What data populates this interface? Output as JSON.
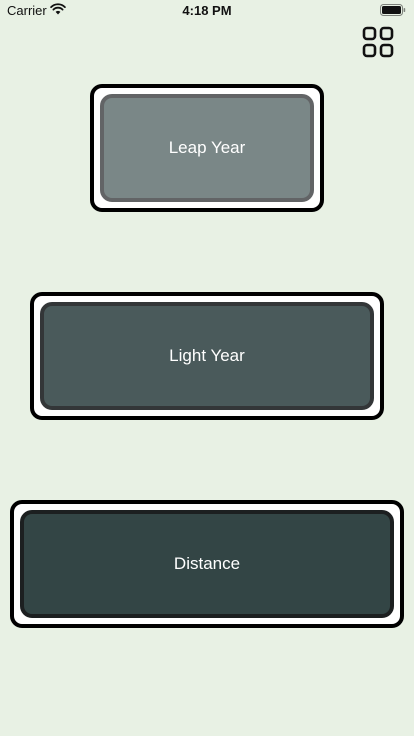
{
  "status_bar": {
    "carrier": "Carrier",
    "time": "4:18 PM"
  },
  "header": {
    "menu_icon": "grid-icon"
  },
  "buttons": [
    {
      "label": "Leap Year",
      "fill": "#7a8787",
      "border": "#626466"
    },
    {
      "label": "Light Year",
      "fill": "#4a5a5b",
      "border": "#333638"
    },
    {
      "label": "Distance",
      "fill": "#334545",
      "border": "#1c1f20"
    }
  ],
  "colors": {
    "background": "#e8f1e4",
    "card_outer": "#ffffff",
    "card_outline": "#000000",
    "label_text": "#ffffff"
  }
}
